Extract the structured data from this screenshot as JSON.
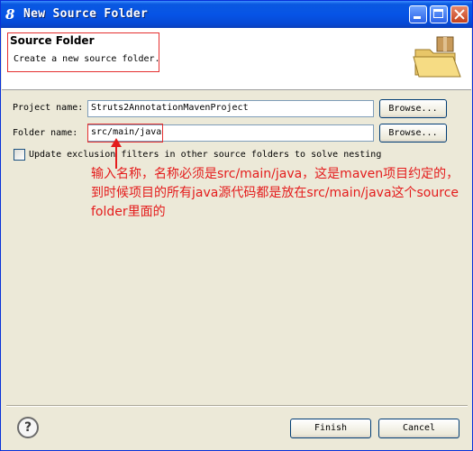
{
  "window": {
    "title": "New Source Folder",
    "title_icon": "8",
    "controls": {
      "minimize": "minimize-icon",
      "maximize": "maximize-icon",
      "close": "close-icon"
    }
  },
  "header": {
    "title": "Source Folder",
    "description": "Create a new source folder.",
    "icon": "folder-icon"
  },
  "form": {
    "project_label": "Project name:",
    "project_value": "Struts2AnnotationMavenProject",
    "folder_label": "Folder name:",
    "folder_value": "src/main/java",
    "browse_label": "Browse...",
    "checkbox_label": "Update exclusion filters in other source folders to solve nesting",
    "checkbox_checked": false
  },
  "annotation": {
    "text": "输入名称，名称必须是src/main/java，这是maven项目约定的，到时候项目的所有java源代码都是放在src/main/java这个source folder里面的",
    "color": "#e41c1c"
  },
  "footer": {
    "help_glyph": "?",
    "finish_label": "Finish",
    "cancel_label": "Cancel"
  },
  "colors": {
    "title_bar": "#0654e6",
    "dialog_bg": "#ece9d8",
    "highlight": "#e53030"
  }
}
